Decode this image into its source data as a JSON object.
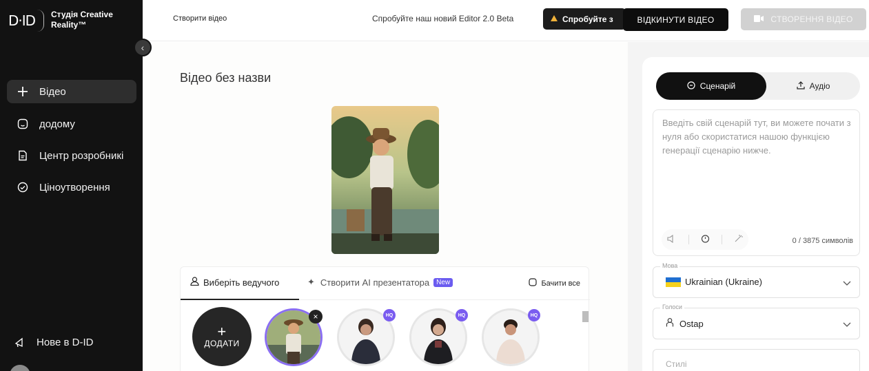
{
  "sidebar": {
    "logo": "D·ID",
    "brand_line1": "Студія Creative",
    "brand_line2": "Reality™",
    "items": [
      {
        "label": "Відео",
        "icon": "plus-icon"
      },
      {
        "label": "додому",
        "icon": "home-icon"
      },
      {
        "label": "Центр розробникі",
        "icon": "document-icon"
      },
      {
        "label": "Ціноутворення",
        "icon": "tag-icon"
      }
    ],
    "whats_new": "Нове в D-ID"
  },
  "header": {
    "create_label": "Створити відео",
    "try_text": "Спробуйте наш новий Editor 2.0 Beta",
    "try_button": "Спробуйте з",
    "discard_button": "ВІДКИНУТИ ВІДЕО",
    "generate_button": "СТВОРЕННЯ ВІДЕО"
  },
  "main": {
    "video_title": "Відео без назви",
    "tabs": {
      "choose_presenter": "Виберіть ведучого",
      "create_ai": "Створити AI презентатора",
      "new_badge": "New",
      "see_all": "Бачити все"
    },
    "add_label": "ДОДАТИ",
    "hq_label": "HQ"
  },
  "right": {
    "tab_script": "Сценарій",
    "tab_audio": "Аудіо",
    "script_placeholder": "Введіть свій сценарій тут, ви можете почати з нуля або скористатися нашою функцією генерації сценарію нижче.",
    "char_count": "0 / 3875 символів",
    "language_label": "Мова",
    "language_value": "Ukrainian (Ukraine)",
    "voices_label": "Голоси",
    "voice_value": "Ostap",
    "styles_placeholder": "Стилі"
  },
  "colors": {
    "accent": "#7a5cf0",
    "sidebar_bg": "#121212"
  }
}
